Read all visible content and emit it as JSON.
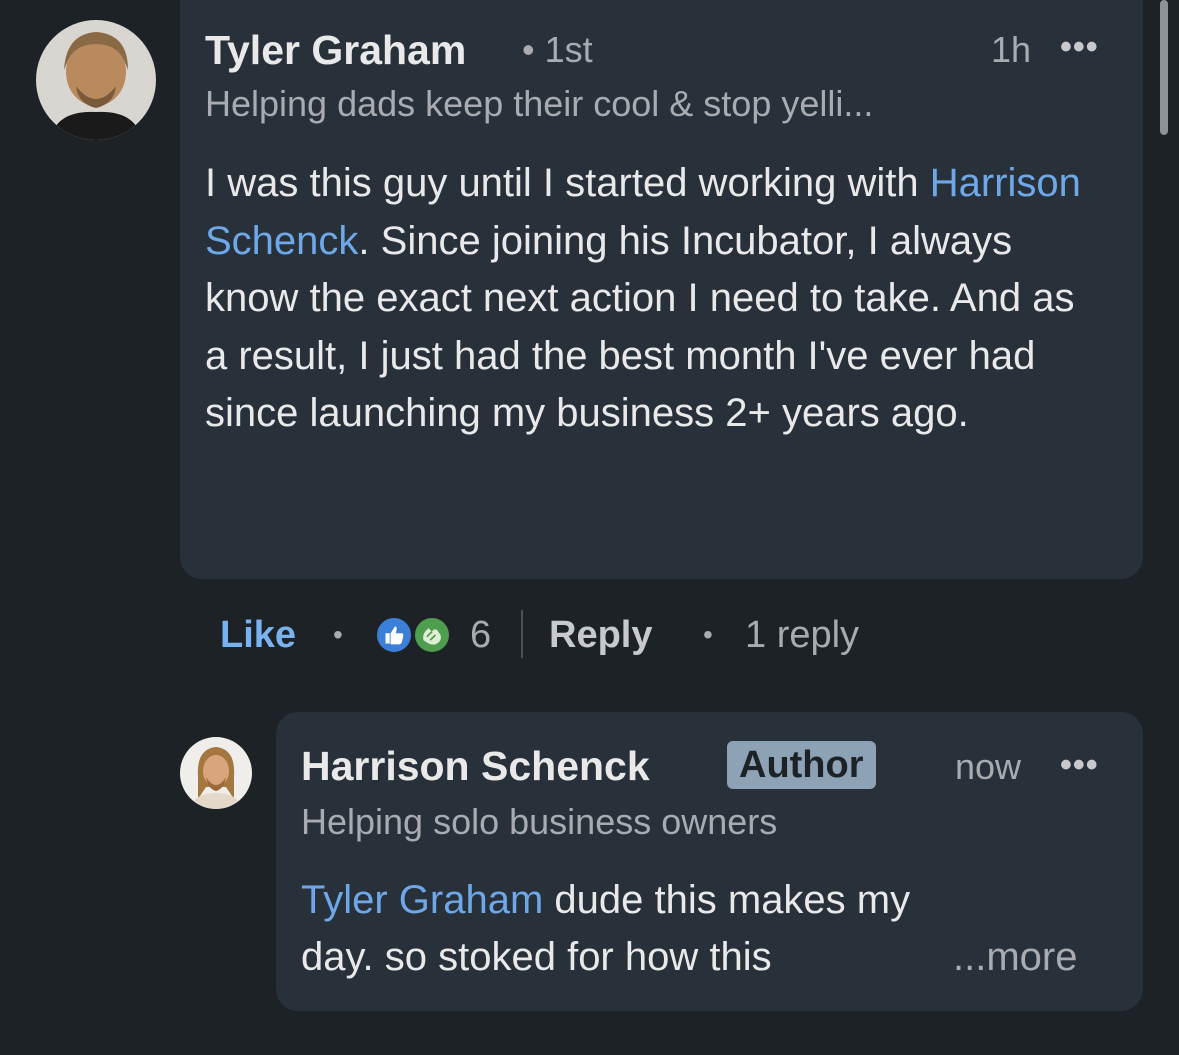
{
  "comment": {
    "author": "Tyler Graham",
    "degree": "• 1st",
    "time": "1h",
    "headline": "Helping dads keep their cool & stop yelli...",
    "text_part1": "I was this guy until I started working with ",
    "mention": "Harrison Schenck",
    "text_part2": ".  Since joining his Incubator, I always know the exact next action I need to take.  And as a result, I just had the best month I've ever had since launching my business 2+ years ago.",
    "actions": {
      "like": "Like",
      "dot1": "•",
      "reaction_count": "6",
      "reply": "Reply",
      "dot2": "•",
      "replies": "1 reply"
    }
  },
  "reply": {
    "author": "Harrison Schenck",
    "badge": "Author",
    "time": "now",
    "headline": "Helping solo business owners",
    "mention": "Tyler Graham",
    "text_line1_rest": " dude this makes my",
    "text_line2": "day. so stoked for how this",
    "more": "...more"
  },
  "icons": {
    "overflow": "more-horizontal-icon",
    "reaction_like": "like-reaction-icon",
    "reaction_celebrate": "celebrate-reaction-icon"
  },
  "colors": {
    "background": "#1d2226",
    "bubble": "#283039",
    "mention": "#6fa8e8",
    "like": "#78b3f0",
    "badge": "#8ea2b6"
  }
}
